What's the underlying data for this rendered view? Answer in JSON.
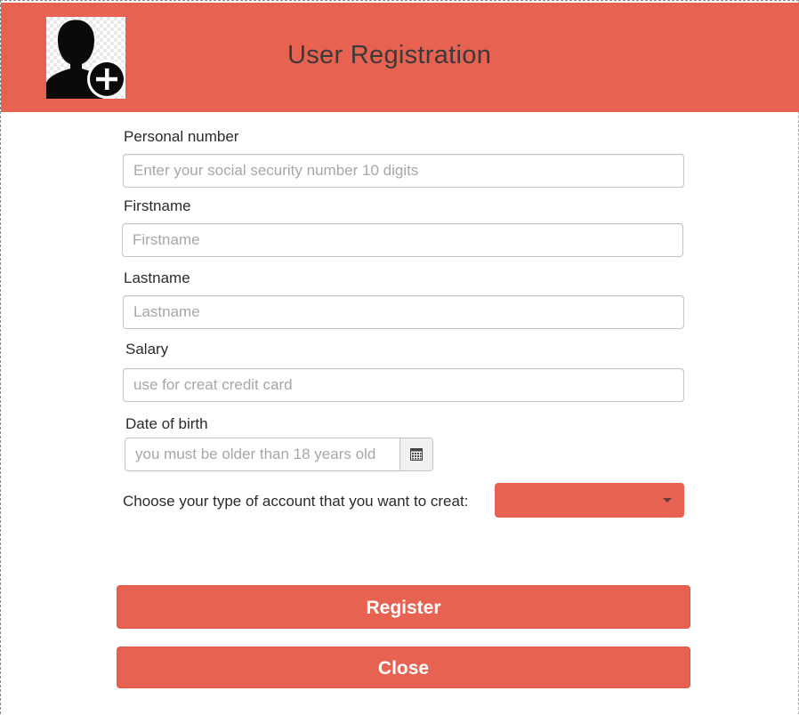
{
  "header": {
    "title": "User Registration",
    "avatar_icon": "user-add-icon",
    "background_color": "#e86252"
  },
  "form": {
    "personal_number": {
      "label": "Personal number",
      "placeholder": "Enter your social security number 10 digits",
      "value": ""
    },
    "firstname": {
      "label": "Firstname",
      "placeholder": "Firstname",
      "value": ""
    },
    "lastname": {
      "label": "Lastname",
      "placeholder": "Lastname",
      "value": ""
    },
    "salary": {
      "label": "Salary",
      "placeholder": "use for creat credit card",
      "value": ""
    },
    "date_of_birth": {
      "label": "Date of birth",
      "placeholder": "you must be older than 18 years old",
      "value": "",
      "picker_icon": "calendar-icon"
    },
    "account_type": {
      "label": "Choose your type of account that you want to creat:",
      "selected": "",
      "dropdown_icon": "chevron-down-icon"
    }
  },
  "actions": {
    "register_label": "Register",
    "close_label": "Close"
  },
  "colors": {
    "accent": "#e86252",
    "text": "#2b2b2b",
    "placeholder": "#a7a7a7"
  }
}
